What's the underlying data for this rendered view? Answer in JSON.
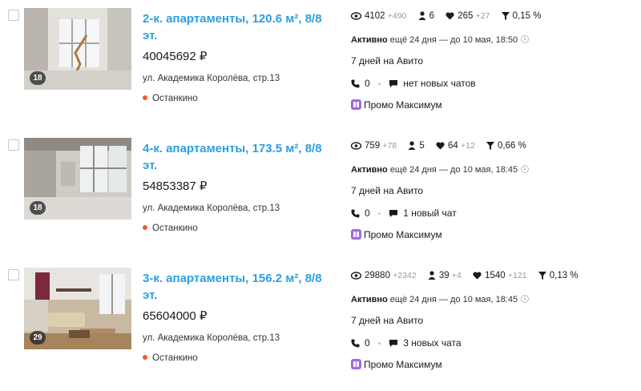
{
  "listings": [
    {
      "title": "2-к. апартаменты, 120.6 м², 8/8 эт.",
      "price": "40045692 ₽",
      "photo_count": "18",
      "address": "ул. Академика Королёва, стр.13",
      "metro": "Останкино",
      "views": "4102",
      "views_delta": "+490",
      "contacts_count": "6",
      "contacts_delta": "",
      "favorites": "265",
      "favorites_delta": "+27",
      "conversion": "0,15 %",
      "status_label": "Активно",
      "status_text": " ещё 24 дня — до 10 мая, 18:50",
      "duration": "7 дней на Авито",
      "calls": "0",
      "chats": "нет новых чатов",
      "promo": "Промо Максимум"
    },
    {
      "title": "4-к. апартаменты, 173.5 м², 8/8 эт.",
      "price": "54853387 ₽",
      "photo_count": "18",
      "address": "ул. Академика Королёва, стр.13",
      "metro": "Останкино",
      "views": "759",
      "views_delta": "+78",
      "contacts_count": "5",
      "contacts_delta": "",
      "favorites": "64",
      "favorites_delta": "+12",
      "conversion": "0,66 %",
      "status_label": "Активно",
      "status_text": " ещё 24 дня — до 10 мая, 18:45",
      "duration": "7 дней на Авито",
      "calls": "0",
      "chats": "1 новый чат",
      "promo": "Промо Максимум"
    },
    {
      "title": "3-к. апартаменты, 156.2 м², 8/8 эт.",
      "price": "65604000 ₽",
      "photo_count": "29",
      "address": "ул. Академика Королёва, стр.13",
      "metro": "Останкино",
      "views": "29880",
      "views_delta": "+2342",
      "contacts_count": "39",
      "contacts_delta": "+4",
      "favorites": "1540",
      "favorites_delta": "+121",
      "conversion": "0,13 %",
      "status_label": "Активно",
      "status_text": " ещё 24 дня — до 10 мая, 18:45",
      "duration": "7 дней на Авито",
      "calls": "0",
      "chats": "3 новых чата",
      "promo": "Промо Максимум"
    }
  ],
  "colors": {
    "title_link": "#2c9fe2",
    "metro_dot": "#f45a2c",
    "promo": "#a268e6",
    "delta": "#999999"
  },
  "icons": {
    "views": "eye-icon",
    "contacts": "person-icon",
    "favorites": "heart-icon",
    "conversion": "funnel-icon",
    "calls": "phone-icon",
    "chats": "chat-bubble-icon",
    "status": "clock-icon",
    "promo": "promo-icon"
  }
}
